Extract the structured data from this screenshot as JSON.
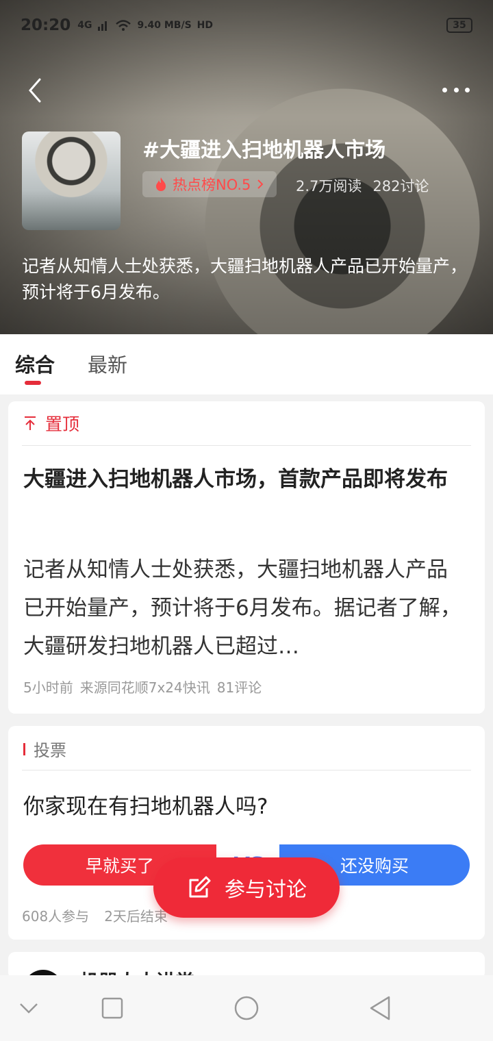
{
  "status_bar": {
    "time": "20:20",
    "network": "4G",
    "speed": "9.40 MB/S",
    "hd": "HD",
    "battery": "35"
  },
  "topic": {
    "title": "#大疆进入扫地机器人市场",
    "hot_rank": "热点榜NO.5",
    "reads": "2.7万阅读",
    "discussions": "282讨论",
    "description": "记者从知情人士处获悉，大疆扫地机器人产品已开始量产，预计将于6月发布。"
  },
  "tabs": [
    {
      "label": "综合",
      "active": true
    },
    {
      "label": "最新",
      "active": false
    }
  ],
  "pinned": {
    "label": "置顶",
    "title": "大疆进入扫地机器人市场，首款产品即将发布",
    "body": "记者从知情人士处获悉，大疆扫地机器人产品已开始量产，预计将于6月发布。据记者了解，大疆研发扫地机器人已超过…",
    "time": "5小时前",
    "source": "来源同花顺7x24快讯",
    "comments": "81评论"
  },
  "vote": {
    "label": "投票",
    "question": "你家现在有扫地机器人吗?",
    "option_left": "早就买了",
    "vs": "VS",
    "option_right": "还没购买",
    "participants": "608人参与",
    "ends": "2天后结束"
  },
  "next_post": {
    "author": "机器人大讲堂"
  },
  "fab": {
    "label": "参与讨论"
  },
  "colors": {
    "accent_red": "#ef2a38",
    "vote_blue": "#3b7cf5"
  }
}
